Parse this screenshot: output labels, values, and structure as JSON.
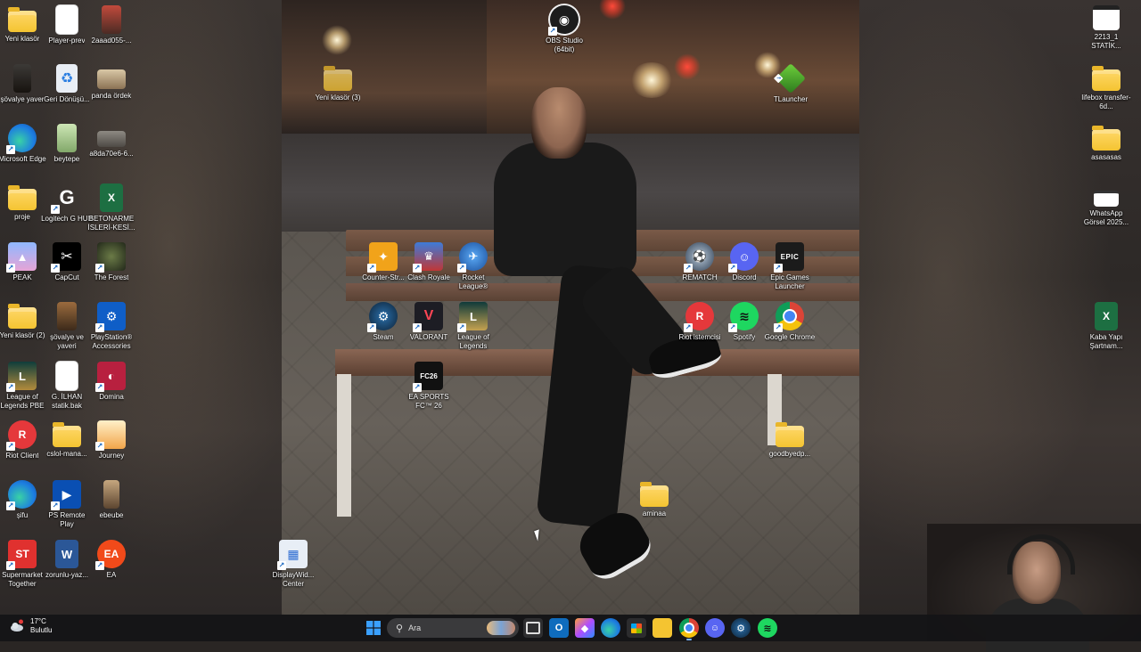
{
  "desktop": {
    "icons": [
      {
        "label": "Yeni klasör",
        "type": "folder"
      },
      {
        "label": "Player-prev",
        "type": "file"
      },
      {
        "label": "2aaad055-...",
        "type": "image"
      },
      {
        "label": "şövalye yaver",
        "type": "image"
      },
      {
        "label": "Geri Dönüşü...",
        "type": "recycle"
      },
      {
        "label": "panda ördek",
        "type": "image"
      },
      {
        "label": "Microsoft Edge",
        "type": "app"
      },
      {
        "label": "beytepe",
        "type": "image"
      },
      {
        "label": "a8da70e6-6...",
        "type": "image"
      },
      {
        "label": "proje",
        "type": "folder"
      },
      {
        "label": "Logitech G HUB",
        "type": "app"
      },
      {
        "label": "BETONARME İSLERİ-KESİ...",
        "type": "excel"
      },
      {
        "label": "PEAK",
        "type": "app"
      },
      {
        "label": "CapCut",
        "type": "app"
      },
      {
        "label": "The Forest",
        "type": "app"
      },
      {
        "label": "Yeni klasör (2)",
        "type": "folder"
      },
      {
        "label": "şövalye ve yaveri",
        "type": "image"
      },
      {
        "label": "PlayStation® Accessories",
        "type": "app"
      },
      {
        "label": "League of Legends PBE",
        "type": "app"
      },
      {
        "label": "G. İLHAN statik.bak",
        "type": "file"
      },
      {
        "label": "Domina",
        "type": "app"
      },
      {
        "label": "Riot Client",
        "type": "app"
      },
      {
        "label": "cslol-mana...",
        "type": "folder"
      },
      {
        "label": "Journey",
        "type": "app"
      },
      {
        "label": "şifu",
        "type": "app"
      },
      {
        "label": "PS Remote Play",
        "type": "app"
      },
      {
        "label": "ebeube",
        "type": "image"
      },
      {
        "label": "Supermarket Together",
        "type": "app"
      },
      {
        "label": "zorunlu-yaz...",
        "type": "word"
      },
      {
        "label": "EA",
        "type": "app"
      },
      {
        "label": "OBS Studio (64bit)",
        "type": "app"
      },
      {
        "label": "Yeni klasör (3)",
        "type": "folder"
      },
      {
        "label": "TLauncher",
        "type": "app"
      },
      {
        "label": "Counter-Str...",
        "type": "app"
      },
      {
        "label": "Clash Royale",
        "type": "app"
      },
      {
        "label": "Rocket League®",
        "type": "app"
      },
      {
        "label": "REMATCH",
        "type": "app"
      },
      {
        "label": "Discord",
        "type": "app"
      },
      {
        "label": "Epic Games Launcher",
        "type": "app"
      },
      {
        "label": "Steam",
        "type": "app"
      },
      {
        "label": "VALORANT",
        "type": "app"
      },
      {
        "label": "League of Legends",
        "type": "app"
      },
      {
        "label": "Riot istemcisi",
        "type": "app"
      },
      {
        "label": "Spotify",
        "type": "app"
      },
      {
        "label": "Google Chrome",
        "type": "app"
      },
      {
        "label": "EA SPORTS FC™ 26",
        "type": "app"
      },
      {
        "label": "goodbyedp...",
        "type": "folder"
      },
      {
        "label": "aminaa",
        "type": "folder"
      },
      {
        "label": "DisplayWid... Center",
        "type": "app"
      },
      {
        "label": "2213_1 STATİK...",
        "type": "image"
      },
      {
        "label": "lifebox transfer-6d...",
        "type": "folder"
      },
      {
        "label": "asasasas",
        "type": "folder"
      },
      {
        "label": "WhatsApp Görsel 2025...",
        "type": "image"
      },
      {
        "label": "Kaba Yapı Şartnam...",
        "type": "excel"
      }
    ]
  },
  "taskbar": {
    "weather": {
      "temp": "17°C",
      "condition": "Bulutlu"
    },
    "search_placeholder": "Ara",
    "apps": [
      {
        "name": "task-view-icon"
      },
      {
        "name": "outlook-icon"
      },
      {
        "name": "copilot-icon"
      },
      {
        "name": "edge-icon"
      },
      {
        "name": "store-icon"
      },
      {
        "name": "file-explorer-icon"
      },
      {
        "name": "chrome-icon"
      },
      {
        "name": "discord-icon"
      },
      {
        "name": "steam-icon"
      },
      {
        "name": "spotify-icon"
      }
    ]
  },
  "colors": {
    "folder": "#f4c431",
    "taskbar": "#141416",
    "accent": "#7ab6ff"
  }
}
